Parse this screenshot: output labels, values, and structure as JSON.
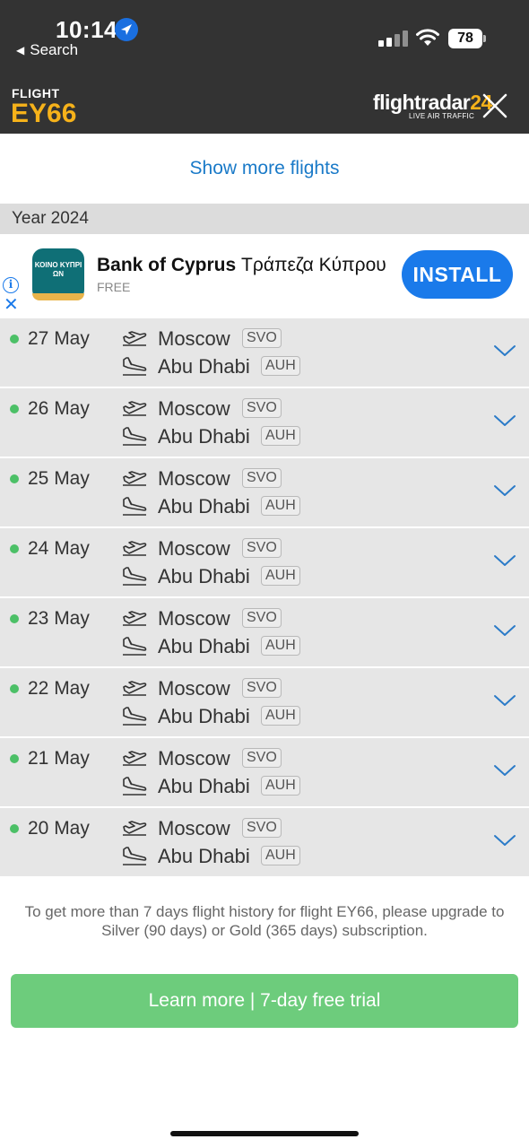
{
  "status_bar": {
    "time": "10:14",
    "back_label": "Search",
    "battery": "78"
  },
  "header": {
    "label": "FLIGHT",
    "flight_number": "EY66",
    "brand_main": "flightradar",
    "brand_num": "24",
    "brand_sub": "LIVE AIR TRAFFIC",
    "accent_color": "#f6b21a"
  },
  "show_more": "Show more flights",
  "year_label": "Year 2024",
  "ad": {
    "logo_text": "ΚΟΙΝΟ ΚΥΠΡΙ ΩΝ",
    "title_bold": "Bank of Cyprus",
    "title_rest": "Τράπεζα Κύπρου",
    "subtitle": "FREE",
    "install_label": "INSTALL",
    "info_glyph": "i",
    "close_glyph": "✕"
  },
  "flights": [
    {
      "date": "27 May",
      "from_city": "Moscow",
      "from_code": "SVO",
      "to_city": "Abu Dhabi",
      "to_code": "AUH"
    },
    {
      "date": "26 May",
      "from_city": "Moscow",
      "from_code": "SVO",
      "to_city": "Abu Dhabi",
      "to_code": "AUH"
    },
    {
      "date": "25 May",
      "from_city": "Moscow",
      "from_code": "SVO",
      "to_city": "Abu Dhabi",
      "to_code": "AUH"
    },
    {
      "date": "24 May",
      "from_city": "Moscow",
      "from_code": "SVO",
      "to_city": "Abu Dhabi",
      "to_code": "AUH"
    },
    {
      "date": "23 May",
      "from_city": "Moscow",
      "from_code": "SVO",
      "to_city": "Abu Dhabi",
      "to_code": "AUH"
    },
    {
      "date": "22 May",
      "from_city": "Moscow",
      "from_code": "SVO",
      "to_city": "Abu Dhabi",
      "to_code": "AUH"
    },
    {
      "date": "21 May",
      "from_city": "Moscow",
      "from_code": "SVO",
      "to_city": "Abu Dhabi",
      "to_code": "AUH"
    },
    {
      "date": "20 May",
      "from_city": "Moscow",
      "from_code": "SVO",
      "to_city": "Abu Dhabi",
      "to_code": "AUH"
    }
  ],
  "upgrade_note": "To get more than 7 days flight history for flight EY66, please upgrade to Silver (90 days) or Gold (365 days) subscription.",
  "learn_more_label": "Learn more | 7-day free trial",
  "colors": {
    "status_dot": "#4cc067",
    "link": "#1a7ac8",
    "cta_green": "#6dcc7c",
    "install_blue": "#1a7aea"
  }
}
